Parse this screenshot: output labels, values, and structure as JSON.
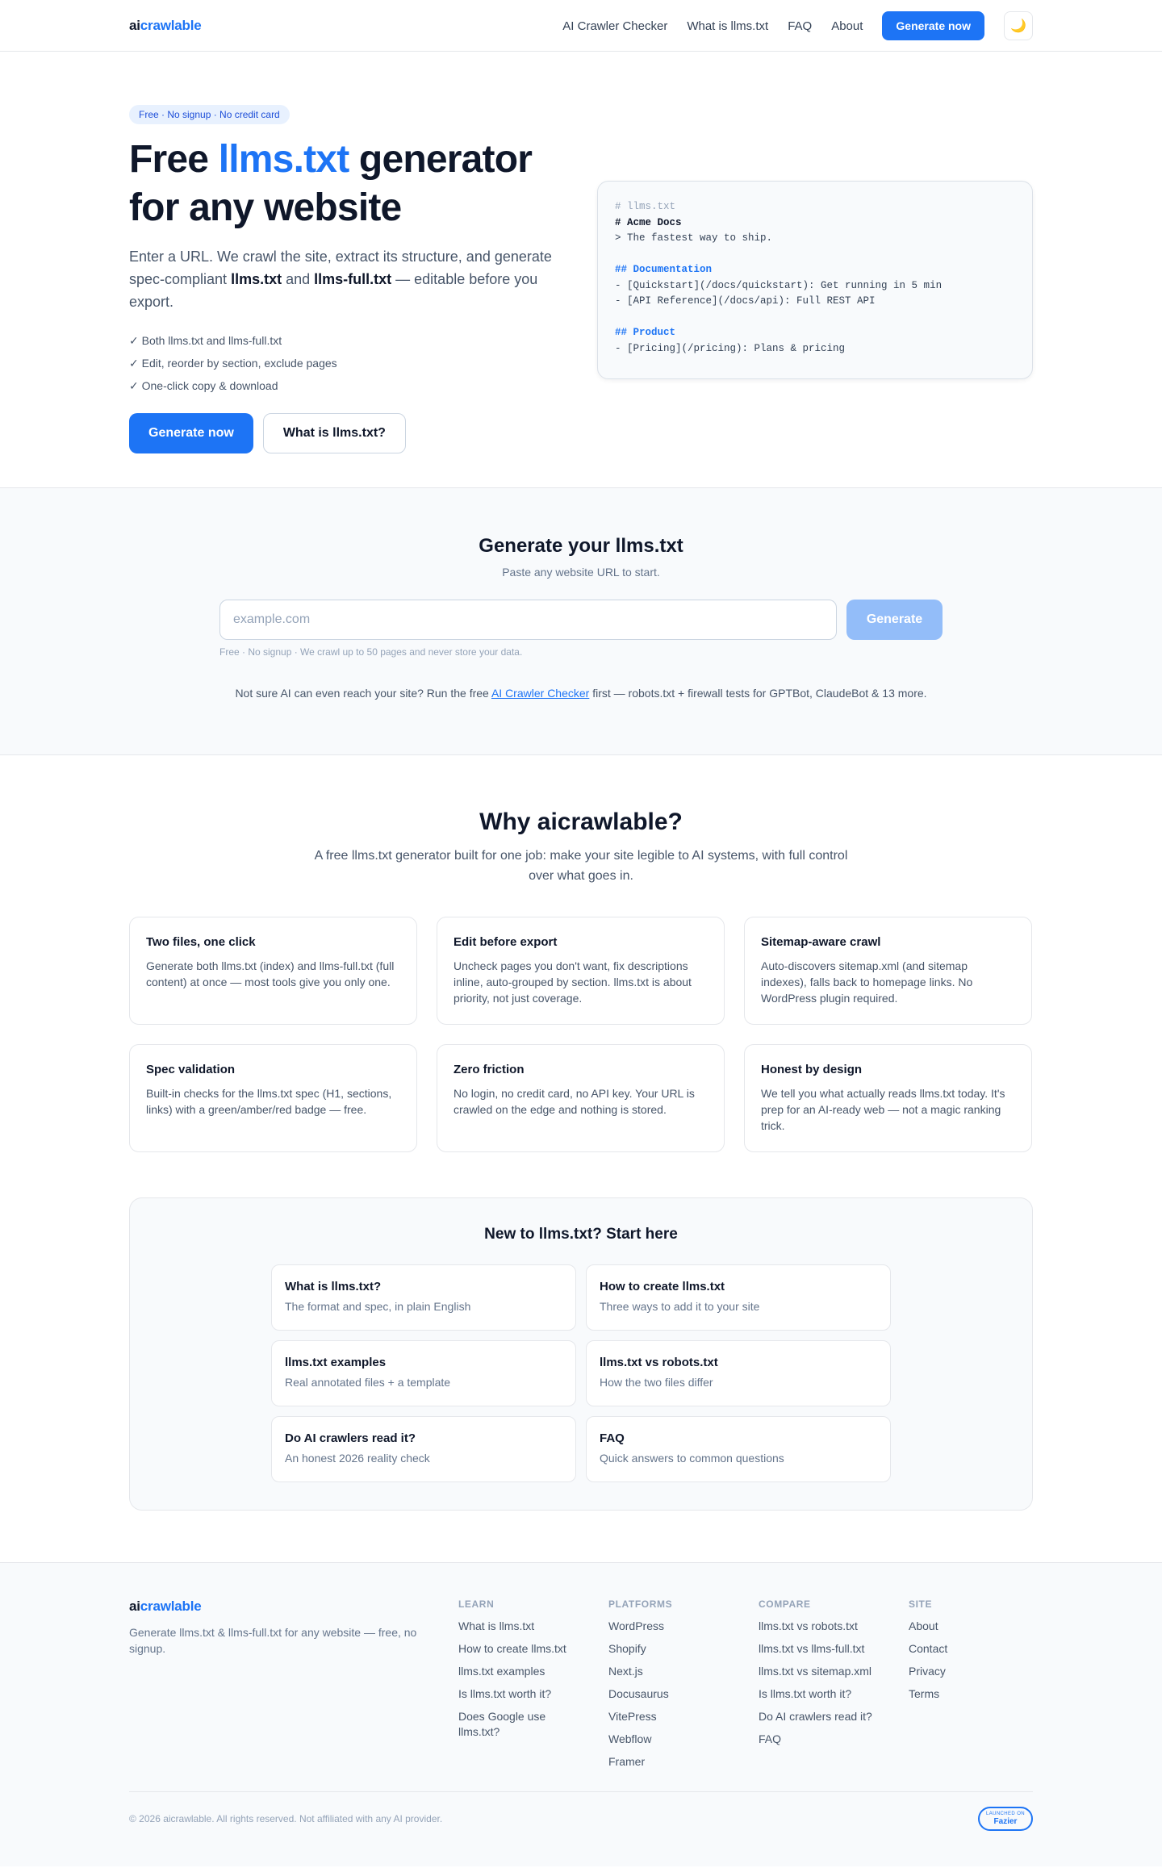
{
  "nav": {
    "logo_ai": "ai",
    "logo_rest": "crawlable",
    "links": [
      "AI Crawler Checker",
      "What is llms.txt",
      "FAQ",
      "About"
    ],
    "cta": "Generate now",
    "theme_icon": "🌙"
  },
  "hero": {
    "badge": "Free · No signup · No credit card",
    "title_part1": "Free ",
    "title_accent": "llms.txt",
    "title_part2": " generator",
    "title_line2": "for any website",
    "desc_part1": "Enter a URL. We crawl the site, extract its structure, and generate spec-compliant ",
    "desc_b1": "llms.txt",
    "desc_part2": " and ",
    "desc_b2": "llms-full.txt",
    "desc_part3": " — editable before you export.",
    "checks": [
      "✓ Both llms.txt and llms-full.txt",
      "✓ Edit, reorder by section, exclude pages",
      "✓ One-click copy & download"
    ],
    "cta_primary": "Generate now",
    "cta_secondary": "What is llms.txt?"
  },
  "code_sample": {
    "comment": "# llms.txt",
    "h1": "# Acme Docs",
    "quote": "> The fastest way to ship.",
    "section1": "## Documentation",
    "line1": "- [Quickstart](/docs/quickstart): Get running in 5 min",
    "line2": "- [API Reference](/docs/api): Full REST API",
    "section2": "## Product",
    "line3": "- [Pricing](/pricing): Plans & pricing"
  },
  "generate": {
    "title": "Generate your llms.txt",
    "subtitle": "Paste any website URL to start.",
    "input_placeholder": "example.com",
    "button": "Generate",
    "note": "Free · No signup · We crawl up to 50 pages and never store your data.",
    "hint_before": "Not sure AI can even reach your site? Run the free ",
    "hint_link": "AI Crawler Checker",
    "hint_after": " first — robots.txt + firewall tests for GPTBot, ClaudeBot & 13 more."
  },
  "why": {
    "title": "Why aicrawlable?",
    "lead": "A free llms.txt generator built for one job: make your site legible to AI systems, with full control over what goes in.",
    "features": [
      {
        "title": "Two files, one click",
        "text": "Generate both llms.txt (index) and llms-full.txt (full content) at once — most tools give you only one."
      },
      {
        "title": "Edit before export",
        "text": "Uncheck pages you don't want, fix descriptions inline, auto-grouped by section. llms.txt is about priority, not just coverage."
      },
      {
        "title": "Sitemap-aware crawl",
        "text": "Auto-discovers sitemap.xml (and sitemap indexes), falls back to homepage links. No WordPress plugin required."
      },
      {
        "title": "Spec validation",
        "text": "Built-in checks for the llms.txt spec (H1, sections, links) with a green/amber/red badge — free."
      },
      {
        "title": "Zero friction",
        "text": "No login, no credit card, no API key. Your URL is crawled on the edge and nothing is stored."
      },
      {
        "title": "Honest by design",
        "text": "We tell you what actually reads llms.txt today. It's prep for an AI-ready web — not a magic ranking trick."
      }
    ]
  },
  "start": {
    "title": "New to llms.txt? Start here",
    "cards": [
      {
        "title": "What is llms.txt?",
        "sub": "The format and spec, in plain English"
      },
      {
        "title": "How to create llms.txt",
        "sub": "Three ways to add it to your site"
      },
      {
        "title": "llms.txt examples",
        "sub": "Real annotated files + a template"
      },
      {
        "title": "llms.txt vs robots.txt",
        "sub": "How the two files differ"
      },
      {
        "title": "Do AI crawlers read it?",
        "sub": "An honest 2026 reality check"
      },
      {
        "title": "FAQ",
        "sub": "Quick answers to common questions"
      }
    ]
  },
  "footer": {
    "logo_ai": "ai",
    "logo_rest": "crawlable",
    "tagline": "Generate llms.txt & llms-full.txt for any website — free, no signup.",
    "columns": [
      {
        "heading": "LEARN",
        "links": [
          "What is llms.txt",
          "How to create llms.txt",
          "llms.txt examples",
          "Is llms.txt worth it?",
          "Does Google use llms.txt?"
        ]
      },
      {
        "heading": "PLATFORMS",
        "links": [
          "WordPress",
          "Shopify",
          "Next.js",
          "Docusaurus",
          "VitePress",
          "Webflow",
          "Framer"
        ]
      },
      {
        "heading": "COMPARE",
        "links": [
          "llms.txt vs robots.txt",
          "llms.txt vs llms-full.txt",
          "llms.txt vs sitemap.xml",
          "Is llms.txt worth it?",
          "Do AI crawlers read it?",
          "FAQ"
        ]
      },
      {
        "heading": "SITE",
        "links": [
          "About",
          "Contact",
          "Privacy",
          "Terms"
        ]
      }
    ],
    "copyright": "© 2026 aicrawlable. All rights reserved. Not affiliated with any AI provider.",
    "fazier_small": "LAUNCHED ON",
    "fazier_big": "Fazier"
  }
}
